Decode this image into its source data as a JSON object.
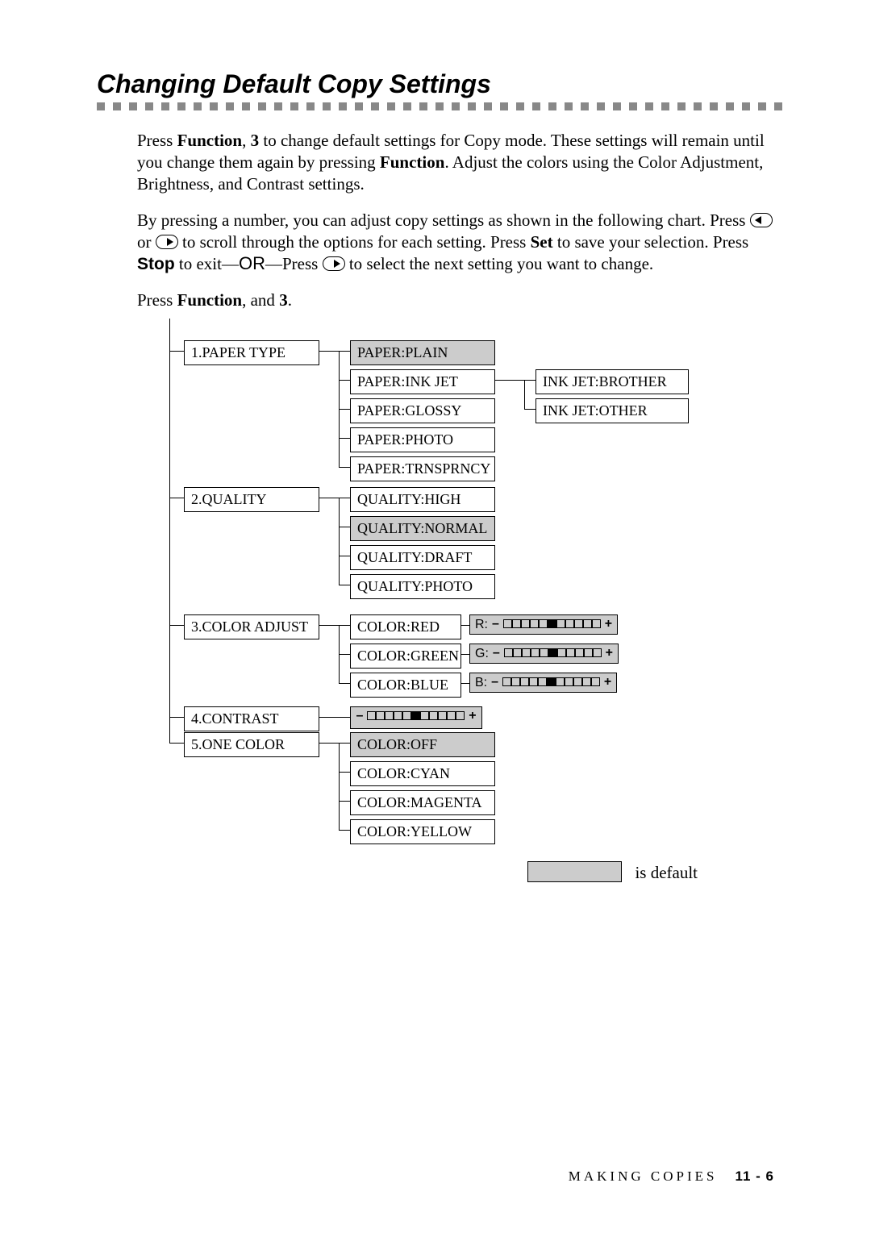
{
  "title": "Changing Default Copy Settings",
  "para1_a": "Press ",
  "para1_b": "Function",
  "para1_c": ", ",
  "para1_d": "3",
  "para1_e": " to change default settings for Copy mode. These settings will remain until you change them again by pressing ",
  "para1_f": "Function",
  "para1_g": ". Adjust the colors using the Color Adjustment, Brightness, and Contrast settings.",
  "para2_a": "By pressing a number, you can adjust copy settings as shown in the following chart. Press ",
  "para2_b": " or ",
  "para2_c": " to scroll through the options for each setting. Press ",
  "para2_d": "Set",
  "para2_e": " to save your selection. Press ",
  "para2_f": "Stop",
  "para2_g": " to exit—",
  "para2_h": "OR",
  "para2_i": "—Press ",
  "para2_j": " to select the next setting you want to change.",
  "instr_a": "Press ",
  "instr_b": "Function",
  "instr_c": ", and ",
  "instr_d": "3",
  "instr_e": ".",
  "menu": {
    "m1": "1.PAPER TYPE",
    "m2": "2.QUALITY",
    "m3": "3.COLOR ADJUST",
    "m4": "4.CONTRAST",
    "m5": "5.ONE COLOR",
    "paper_plain": "PAPER:PLAIN",
    "paper_inkjet": "PAPER:INK JET",
    "paper_glossy": "PAPER:GLOSSY",
    "paper_photo": "PAPER:PHOTO",
    "paper_trns": "PAPER:TRNSPRNCY",
    "inkjet_brother": "INK JET:BROTHER",
    "inkjet_other": "INK JET:OTHER",
    "q_high": "QUALITY:HIGH",
    "q_normal": "QUALITY:NORMAL",
    "q_draft": "QUALITY:DRAFT",
    "q_photo": "QUALITY:PHOTO",
    "c_red": "COLOR:RED",
    "c_green": "COLOR:GREEN",
    "c_blue": "COLOR:BLUE",
    "slider_r": "R:",
    "slider_g": "G:",
    "slider_b": "B:",
    "oc_off": "COLOR:OFF",
    "oc_cyan": "COLOR:CYAN",
    "oc_magenta": "COLOR:MAGENTA",
    "oc_yellow": "COLOR:YELLOW"
  },
  "legend": "is default",
  "footer_section": "MAKING COPIES",
  "footer_page": "11 - 6"
}
